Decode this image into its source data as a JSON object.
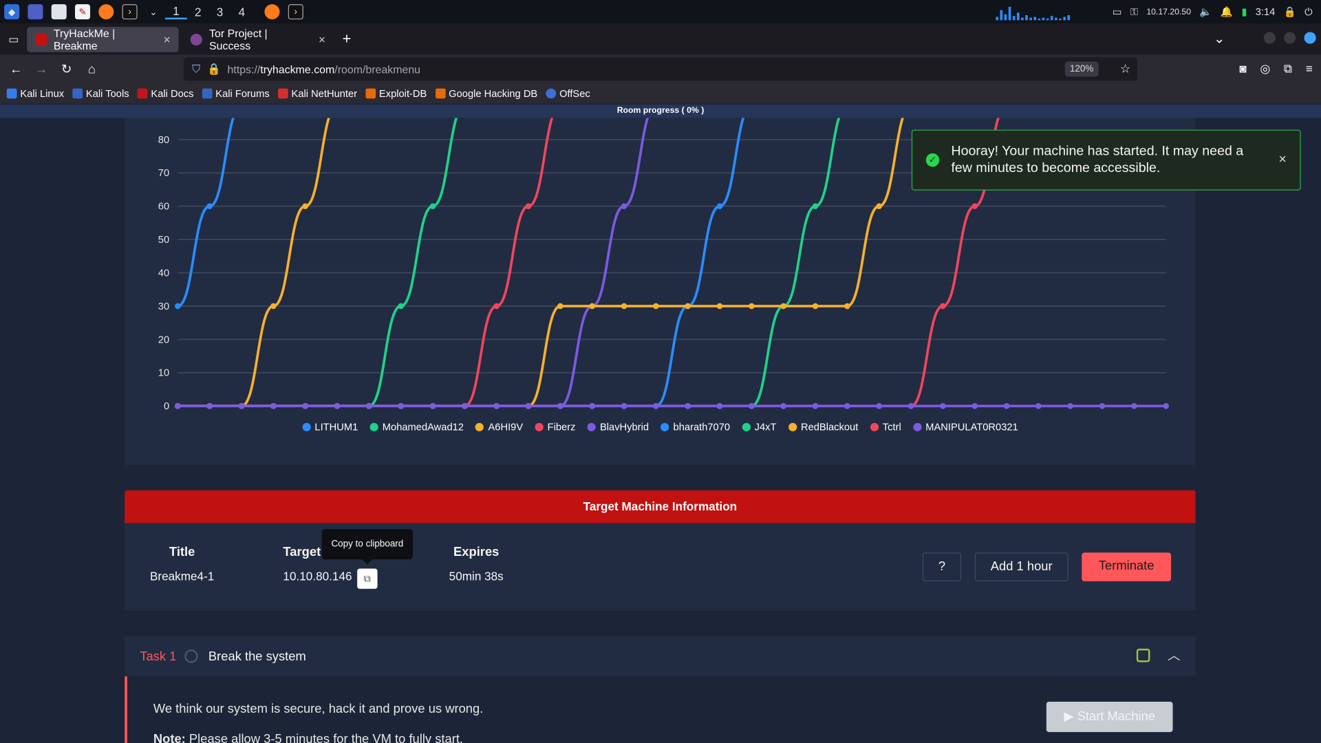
{
  "taskbar": {
    "workspaces": [
      "1",
      "2",
      "3",
      "4"
    ],
    "ip": "10.17.20.50",
    "clock": "3:14"
  },
  "tabs": [
    {
      "title": "TryHackMe | Breakme",
      "close": "×"
    },
    {
      "title": "Tor Project | Success",
      "close": "×"
    }
  ],
  "newtab": "+",
  "url": {
    "scheme": "https://",
    "host": "tryhackme.com",
    "path": "/room/breakmenu",
    "zoom": "120%"
  },
  "bookmarks": [
    "Kali Linux",
    "Kali Tools",
    "Kali Docs",
    "Kali Forums",
    "Kali NetHunter",
    "Exploit-DB",
    "Google Hacking DB",
    "OffSec"
  ],
  "progress": "Room progress ( 0% )",
  "toast": {
    "message": "Hooray! Your machine has started. It may need a few minutes to become accessible.",
    "close": "×"
  },
  "chart_data": {
    "type": "line",
    "y_ticks": [
      0,
      10,
      20,
      30,
      40,
      50,
      60,
      70,
      80
    ],
    "ylim": [
      0,
      85
    ],
    "x_points": 32,
    "grid": true,
    "legend_position": "bottom",
    "series": [
      {
        "name": "LITHUM1",
        "color": "#2b8cff",
        "values": [
          30,
          60,
          90
        ]
      },
      {
        "name": "MohamedAwad12",
        "color": "#1fd28a",
        "values": [
          0,
          0,
          0,
          0,
          0,
          0,
          0,
          30,
          60,
          90
        ]
      },
      {
        "name": "A6HI9V",
        "color": "#f7b12c",
        "values": [
          0,
          0,
          0,
          30,
          60,
          90
        ]
      },
      {
        "name": "Fiberz",
        "color": "#f2455e",
        "values": [
          0,
          0,
          0,
          0,
          0,
          0,
          0,
          0,
          0,
          0,
          30,
          60,
          90
        ]
      },
      {
        "name": "BlavHybrid",
        "color": "#7b5be0",
        "values": [
          0,
          0,
          0,
          0,
          0,
          0,
          0,
          0,
          0,
          0,
          0,
          0,
          0,
          30,
          60,
          90
        ]
      },
      {
        "name": "bharath7070",
        "color": "#2b8cff",
        "values": [
          0,
          0,
          0,
          0,
          0,
          0,
          0,
          0,
          0,
          0,
          0,
          0,
          0,
          0,
          0,
          0,
          30,
          60,
          90
        ]
      },
      {
        "name": "J4xT",
        "color": "#1fd28a",
        "values": [
          0,
          0,
          0,
          0,
          0,
          0,
          0,
          0,
          0,
          0,
          0,
          0,
          0,
          0,
          0,
          0,
          0,
          0,
          0,
          30,
          60,
          90
        ]
      },
      {
        "name": "RedBlackout",
        "color": "#f7b12c",
        "values": [
          0,
          0,
          0,
          0,
          0,
          0,
          0,
          0,
          0,
          0,
          0,
          0,
          30,
          30,
          30,
          30,
          30,
          30,
          30,
          30,
          30,
          30,
          60,
          90
        ]
      },
      {
        "name": "Tctrl",
        "color": "#f2455e",
        "values": [
          0,
          0,
          0,
          0,
          0,
          0,
          0,
          0,
          0,
          0,
          0,
          0,
          0,
          0,
          0,
          0,
          0,
          0,
          0,
          0,
          0,
          0,
          0,
          0,
          30,
          60,
          90
        ]
      },
      {
        "name": "MANIPULAT0R0321",
        "color": "#7b5be0",
        "values": [
          0,
          0,
          0,
          0,
          0,
          0,
          0,
          0,
          0,
          0,
          0,
          0,
          0,
          0,
          0,
          0,
          0,
          0,
          0,
          0,
          0,
          0,
          0,
          0,
          0,
          0,
          0,
          0,
          0,
          0,
          0,
          0
        ]
      }
    ]
  },
  "tmi": {
    "header": "Target Machine Information",
    "title_label": "Title",
    "title_value": "Breakme4-1",
    "target_label": "Target",
    "target_value": "10.10.80.146",
    "tooltip": "Copy to clipboard",
    "expires_label": "Expires",
    "expires_value": "50min 38s",
    "help": "?",
    "add_hour": "Add 1 hour",
    "terminate": "Terminate"
  },
  "task": {
    "number": "Task 1",
    "title": "Break the system",
    "description": "We think our system is secure, hack it and prove us wrong.",
    "note_label": "Note:",
    "note_text": "Please allow 3-5 minutes for the VM to fully start.",
    "start": "Start Machine"
  }
}
